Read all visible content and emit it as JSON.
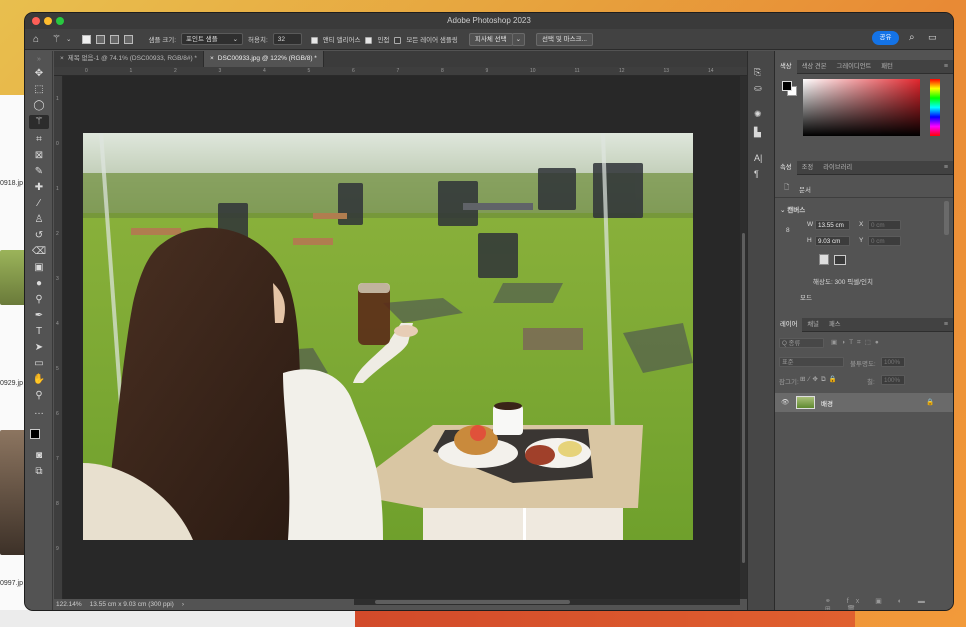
{
  "app": {
    "title": "Adobe Photoshop 2023"
  },
  "desktop": {
    "files": [
      "0918.jp",
      "0929.jp",
      "0997.jp"
    ]
  },
  "options_bar": {
    "sample_size_label": "샘플 크기:",
    "sample_size_value": "포인트 샘플",
    "tolerance_label": "허용치:",
    "tolerance_value": "32",
    "antialias_label": "앤티 앨리어스",
    "contiguous_label": "인접",
    "sample_all_label": "모든 레이어 샘플링",
    "subject_button": "피사체 선택",
    "select_mask_button": "선택 및 마스크...",
    "share_button": "공유"
  },
  "tabs": [
    {
      "label": "제목 없음-1 @ 74.1% (DSC00933, RGB/8#) *",
      "active": false
    },
    {
      "label": "DSC00933.jpg @ 122% (RGB/8) *",
      "active": true
    }
  ],
  "rulers": {
    "top": [
      "0",
      "1",
      "2",
      "3",
      "4",
      "5",
      "6",
      "7",
      "8",
      "9",
      "10",
      "11",
      "12",
      "13",
      "14"
    ],
    "left": [
      "1",
      "0",
      "1",
      "2",
      "3",
      "4",
      "5",
      "6",
      "7",
      "8",
      "9"
    ]
  },
  "status": {
    "zoom": "122.14%",
    "doc_info": "13.55 cm x 9.03 cm (300 ppi)"
  },
  "color_panel": {
    "tabs": [
      "색상",
      "색상 견본",
      "그레이디언트",
      "패턴"
    ],
    "active_tab": "색상"
  },
  "properties_panel": {
    "tabs": [
      "속성",
      "조정",
      "라이브러리"
    ],
    "active_tab": "속성",
    "doc_label": "문서",
    "section": "캔버스",
    "w_label": "W",
    "w_value": "13.55 cm",
    "h_label": "H",
    "h_value": "9.03 cm",
    "x_label": "X",
    "x_value": "0 cm",
    "y_label": "Y",
    "y_value": "0 cm",
    "resolution": "해상도: 300 픽셀/인치",
    "mode_label": "모드"
  },
  "layers_panel": {
    "tabs": [
      "레이어",
      "채널",
      "패스"
    ],
    "active_tab": "레이어",
    "filter_label": "Q 종류",
    "blend_mode": "표준",
    "opacity_label": "불투명도:",
    "opacity_value": "100%",
    "lock_label": "잠그기:",
    "fill_label": "칠:",
    "fill_value": "100%",
    "layers": [
      {
        "name": "배경",
        "visible": true,
        "locked": true
      }
    ]
  },
  "colors": {
    "accent": "#1473e6",
    "foreground": "#000000",
    "background": "#ffffff"
  }
}
